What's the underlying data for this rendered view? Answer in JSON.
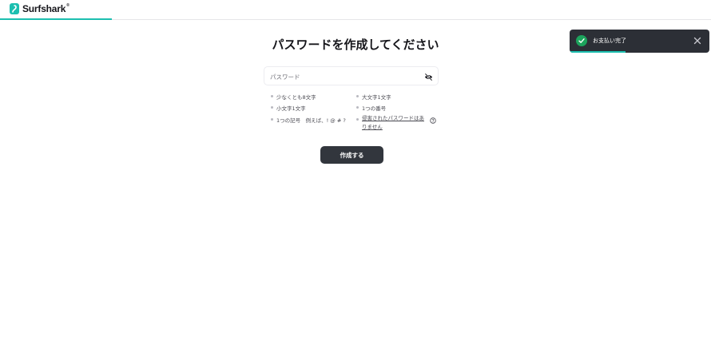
{
  "brand": {
    "name": "Surfshark",
    "mark": "®",
    "accent": "#1cbfb0"
  },
  "header": {
    "progress_fraction": 0.157
  },
  "page": {
    "title": "パスワードを作成してください"
  },
  "password": {
    "placeholder": "パスワード",
    "value": ""
  },
  "rules": {
    "min_length": "少なくとも8文字",
    "uppercase": "大文字1文字",
    "lowercase": "小文字1文字",
    "number": "1つの番号",
    "symbol": "1つの記号　例えば、! @ # ?",
    "breached": "侵害されたパスワードはありません"
  },
  "actions": {
    "create": "作成する"
  },
  "toast": {
    "message": "お支払い完了",
    "status_color": "#1ca35c",
    "progress_fraction": 0.4
  },
  "icons": [
    "surfshark-logo-icon",
    "eye-off-icon",
    "help-icon",
    "check-icon",
    "close-icon"
  ]
}
